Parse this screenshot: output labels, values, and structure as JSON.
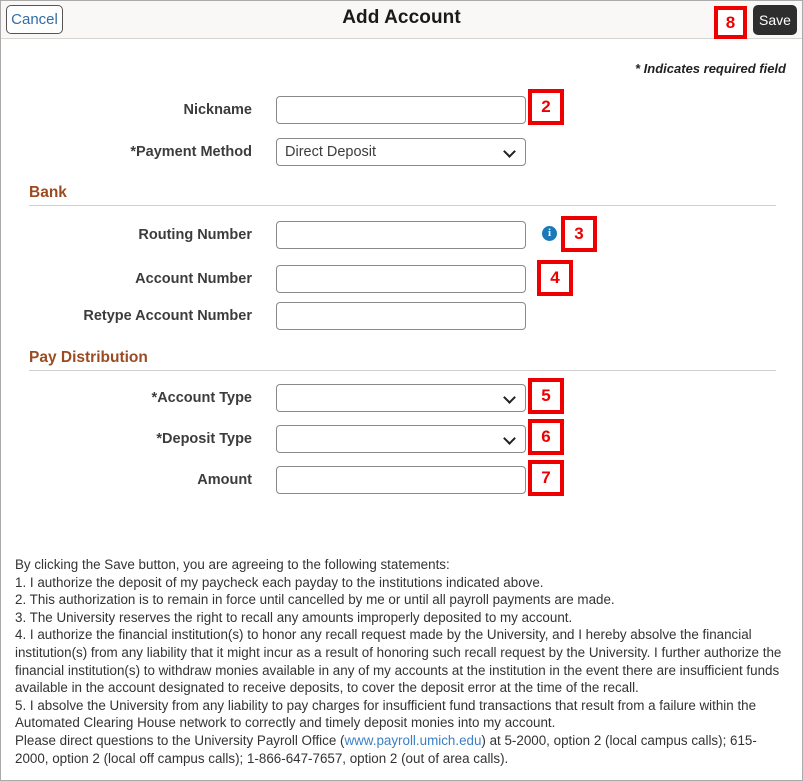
{
  "header": {
    "cancel_label": "Cancel",
    "title": "Add Account",
    "save_label": "Save"
  },
  "required_note": "* Indicates required field",
  "form": {
    "nickname": {
      "label": "Nickname",
      "value": "",
      "placeholder": ""
    },
    "payment_method": {
      "label": "*Payment Method",
      "value": "Direct Deposit"
    },
    "routing_number": {
      "label": "Routing Number",
      "value": "",
      "placeholder": ""
    },
    "account_number": {
      "label": "Account Number",
      "value": "",
      "placeholder": ""
    },
    "retype_account_number": {
      "label": "Retype Account Number",
      "value": "",
      "placeholder": ""
    },
    "account_type": {
      "label": "*Account Type",
      "value": ""
    },
    "deposit_type": {
      "label": "*Deposit Type",
      "value": ""
    },
    "amount": {
      "label": "Amount",
      "value": "",
      "placeholder": ""
    }
  },
  "sections": {
    "bank": "Bank",
    "pay_distribution": "Pay Distribution"
  },
  "icons": {
    "routing_info": "i"
  },
  "callouts": {
    "save": "8",
    "nickname": "2",
    "routing_number": "3",
    "account_number": "4",
    "account_type": "5",
    "deposit_type": "6",
    "amount": "7"
  },
  "legal": {
    "intro": "By clicking the Save button, you are agreeing to the following statements:",
    "item1": "1. I authorize the deposit of my paycheck each payday to the institutions indicated above.",
    "item2": "2. This authorization is to remain in force until cancelled by me or until all payroll payments are made.",
    "item3": "3. The University reserves the right to recall any amounts improperly deposited to my account.",
    "item4": "4. I authorize the financial institution(s) to honor any recall request made by the University, and I hereby absolve the financial institution(s) from any liability that it might incur as a result of honoring such recall request by the University. I further authorize the financial institution(s) to withdraw monies available in any of my accounts at the institution in the event there are insufficient funds available in the account designated to receive deposits, to cover the deposit error at the time of the recall.",
    "item5": "5. I absolve the University from any liability to pay charges for insufficient fund transactions that result from a failure within the Automated Clearing House network to correctly and timely deposit monies into my account.",
    "contact_prefix": "Please direct questions to the University Payroll Office (",
    "contact_link": "www.payroll.umich.edu",
    "contact_suffix": ") at 5-2000, option 2 (local campus calls); 615-2000, option 2 (local off campus calls); 1-866-647-7657, option 2 (out of area calls)."
  },
  "colors": {
    "section_heading": "#9b4b22",
    "link": "#3b7fc4",
    "callout": "#ee0000",
    "save_bg": "#2e2e2e",
    "cancel_text": "#2f6ea8",
    "info_icon": "#1b79b8"
  }
}
